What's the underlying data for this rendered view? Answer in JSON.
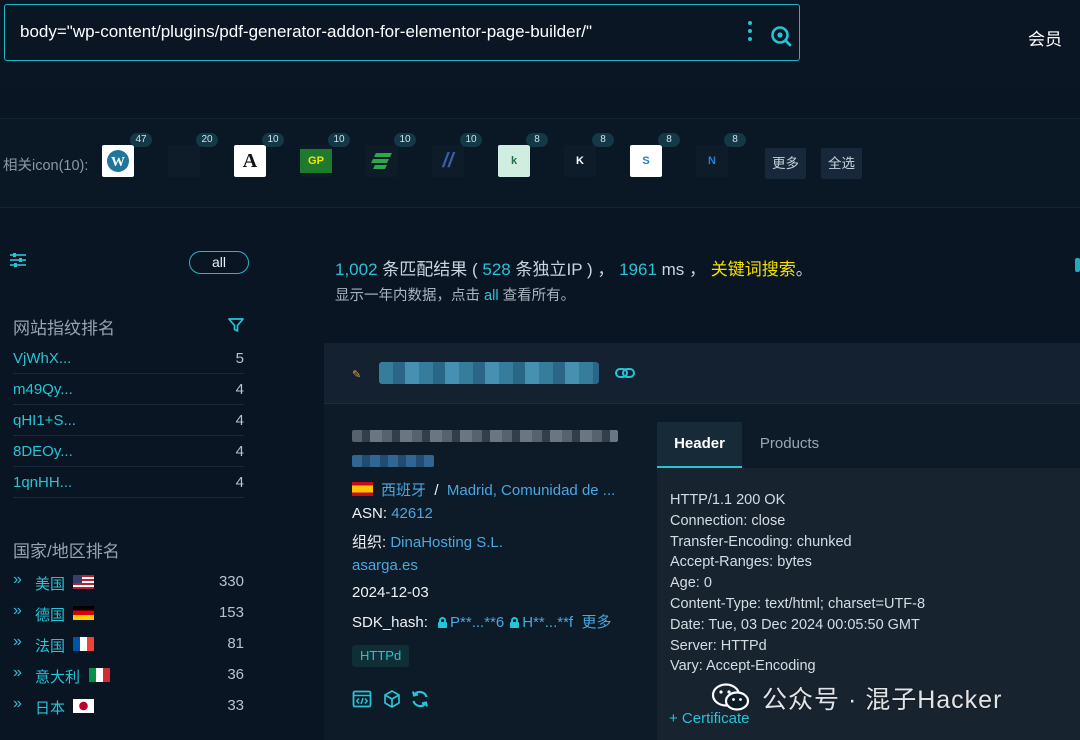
{
  "search": {
    "query": "body=\"wp-content/plugins/pdf-generator-addon-for-elementor-page-builder/\"",
    "member_label": "会员"
  },
  "related_icons": {
    "label": "相关icon(10):",
    "items": [
      {
        "name": "wordpress-icon",
        "count": "47",
        "text": "",
        "bg": "#ffffff"
      },
      {
        "name": "dark-logo-icon",
        "count": "20",
        "text": "",
        "bg": "#0e1c2a"
      },
      {
        "name": "a-logo-icon",
        "count": "10",
        "text": "A",
        "bg": "#ffffff"
      },
      {
        "name": "gp-logo-icon",
        "count": "10",
        "text": "GP",
        "bg": "#1f7a2e"
      },
      {
        "name": "green-stripes-icon",
        "count": "10",
        "text": "",
        "bg": "#0e1c2a"
      },
      {
        "name": "slash-logo-icon",
        "count": "10",
        "text": "//",
        "bg": "#0e1c2a"
      },
      {
        "name": "k-green-icon",
        "count": "8",
        "text": "k",
        "bg": "#cfeee0"
      },
      {
        "name": "k-dark-icon",
        "count": "8",
        "text": "K",
        "bg": "#0e1c2a"
      },
      {
        "name": "s-blue-icon",
        "count": "8",
        "text": "S",
        "bg": "#ffffff"
      },
      {
        "name": "n-blue-icon",
        "count": "8",
        "text": "N",
        "bg": "#0e1c2a"
      }
    ],
    "more_label": "更多",
    "select_all_label": "全选"
  },
  "sidebar": {
    "all_label": "all",
    "fingerprint_title": "网站指纹排名",
    "fingerprints": [
      {
        "key": "VjWhX...",
        "value": "5"
      },
      {
        "key": "m49Qy...",
        "value": "4"
      },
      {
        "key": "qHI1+S...",
        "value": "4"
      },
      {
        "key": "8DEOy...",
        "value": "4"
      },
      {
        "key": "1qnHH...",
        "value": "4"
      }
    ],
    "country_title": "国家/地区排名",
    "countries": [
      {
        "name": "美国",
        "value": "330",
        "flag": "us"
      },
      {
        "name": "德国",
        "value": "153",
        "flag": "de"
      },
      {
        "name": "法国",
        "value": "81",
        "flag": "fr"
      },
      {
        "name": "意大利",
        "value": "36",
        "flag": "it"
      },
      {
        "name": "日本",
        "value": "33",
        "flag": "jp"
      }
    ]
  },
  "summary": {
    "count": "1,002",
    "count_suffix": " 条匹配结果 ( ",
    "ip_count": "528",
    "ip_suffix": " 条独立IP ) ，  ",
    "ms": "1961",
    "ms_suffix": " ms ，  ",
    "keyword_search": "关键词搜索",
    "period": "。",
    "line2_prefix": "显示一年内数据，点击 ",
    "line2_all": "all",
    "line2_suffix": " 查看所有。"
  },
  "result": {
    "country": "西班牙",
    "separator": "/",
    "region": "Madrid, Comunidad de ...",
    "asn_label": "ASN: ",
    "asn": "42612",
    "org_label": "组织: ",
    "org": "DinaHosting S.L.",
    "domain": "asarga.es",
    "date": "2024-12-03",
    "sdk_label": "SDK_hash: ",
    "sdk1": "P**...**6",
    "sdk2": "H**...**f",
    "sdk_more": "更多",
    "tag": "HTTPd",
    "tabs": {
      "header": "Header",
      "products": "Products"
    },
    "header_lines": "HTTP/1.1 200 OK\nConnection: close\nTransfer-Encoding: chunked\nAccept-Ranges: bytes\nAge: 0\nContent-Type: text/html; charset=UTF-8\nDate: Tue, 03 Dec 2024 00:05:50 GMT\nServer: HTTPd\nVary: Accept-Encoding",
    "certificate": "+ Certificate"
  },
  "watermark": "公众号 · 混子Hacker"
}
